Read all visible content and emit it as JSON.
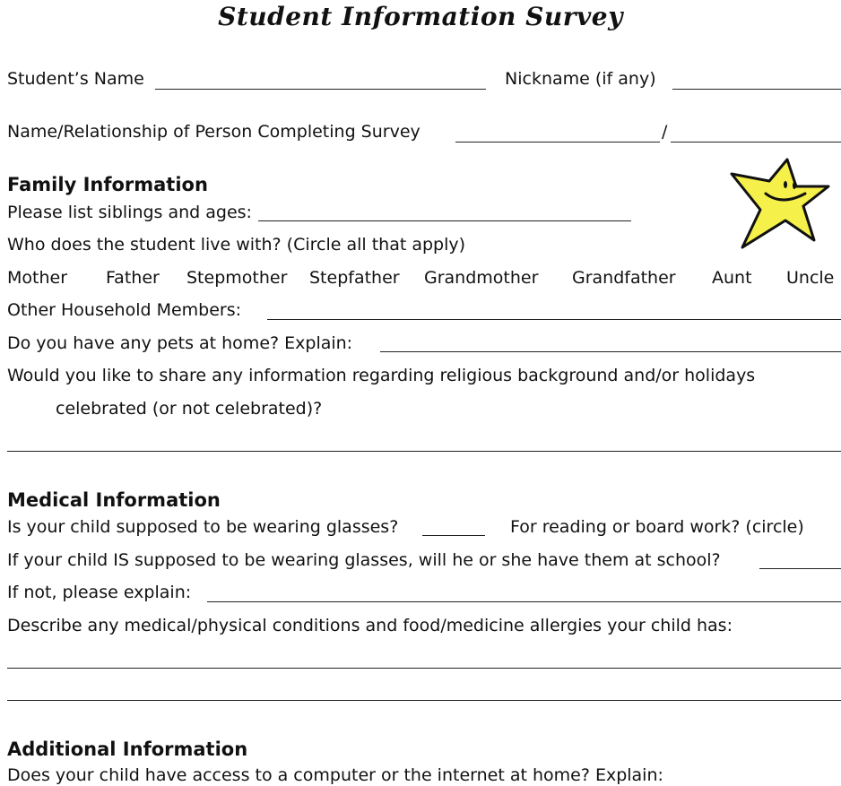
{
  "title": "Student Information Survey",
  "header_fields": {
    "student_name_label": "Student’s Name",
    "student_name_value": "",
    "nickname_label": "Nickname (if any)",
    "nickname_value": "",
    "completer_label": "Name/Relationship of Person Completing Survey",
    "completer_name_value": "",
    "separator": "/",
    "completer_relationship_value": ""
  },
  "family": {
    "heading": "Family Information",
    "siblings_label": "Please list siblings and ages:",
    "siblings_value": "",
    "lives_with_label": "Who does the student live with? (Circle all that apply)",
    "options": [
      "Mother",
      "Father",
      "Stepmother",
      "Stepfather",
      "Grandmother",
      "Grandfather",
      "Aunt",
      "Uncle"
    ],
    "other_members_label": "Other Household Members:",
    "other_members_value": "",
    "pets_label": "Do you have any pets at home? Explain:",
    "pets_value": "",
    "religion_label_1": "Would you like to share any information regarding religious background and/or holidays",
    "religion_label_2": "celebrated (or not celebrated)?",
    "religion_value": ""
  },
  "medical": {
    "heading": "Medical Information",
    "glasses_label": "Is your child supposed to be wearing glasses?",
    "glasses_value": "",
    "reading_board_label": "For reading or board work? (circle)",
    "at_school_label": "If your child IS supposed to be wearing glasses, will he or she have them at school?",
    "at_school_value": "",
    "explain_label": "If not, please explain:",
    "explain_value": "",
    "conditions_label": "Describe any medical/physical conditions and food/medicine allergies your child has:",
    "conditions_value": ""
  },
  "additional": {
    "heading": "Additional Information",
    "computer_label": "Does your child have access to a computer or the internet at home? Explain:"
  },
  "decoration": {
    "icon": "smiling-star-icon",
    "star_color": "#f5f04a"
  }
}
